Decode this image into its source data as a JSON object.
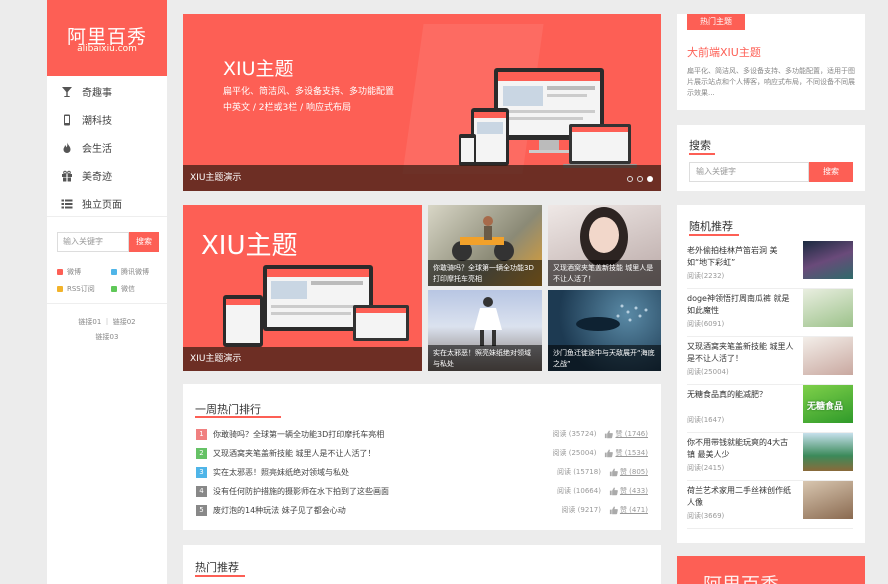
{
  "brand": {
    "name": "阿里百秀",
    "domain": "alibaixiu.com",
    "accent": "#fd5f55"
  },
  "nav": [
    {
      "label": "奇趣事",
      "icon": "glass-icon"
    },
    {
      "label": "潮科技",
      "icon": "phone-icon"
    },
    {
      "label": "会生活",
      "icon": "fire-icon"
    },
    {
      "label": "美奇迹",
      "icon": "gift-icon"
    },
    {
      "label": "独立页面",
      "icon": "list-icon"
    }
  ],
  "sidebar_search": {
    "placeholder": "输入关键字",
    "button": "搜索"
  },
  "social": [
    {
      "label": "微博",
      "color": "#fd5f55"
    },
    {
      "label": "腾讯微博",
      "color": "#4fb5e8"
    },
    {
      "label": "RSS订阅",
      "color": "#f2b32a"
    },
    {
      "label": "微信",
      "color": "#5fc858"
    }
  ],
  "links": {
    "row1": "链接01 ｜ 链接02",
    "row2": "链接03"
  },
  "hero": {
    "title": "XIU主题",
    "line1": "扁平化、简洁风、多设备支持、多功能配置",
    "line2": "中英文 / 2栏或3栏 / 响应式布局",
    "caption": "XIU主题演示"
  },
  "feature": {
    "title": "XIU主题",
    "caption": "XIU主题演示"
  },
  "tiles": [
    "你敢骑吗？全球第一辆全功能3D打印摩托车亮相",
    "又现酒窝夹笔盖新技能 城里人是不让人活了！",
    "实在太邪恶！照亮妹纸绝对领域与私处",
    "沙门鱼迁徙途中与天敌展开“海底之战”"
  ],
  "weekly": {
    "title": "一周热门排行",
    "items": [
      {
        "n": "1",
        "title": "你敢骑吗？全球第一辆全功能3D打印摩托车亮相",
        "views": "阅读 (35724)",
        "likes": "赞 (1746)",
        "color": "#f08080"
      },
      {
        "n": "2",
        "title": "又现酒窝夹笔盖新技能 城里人是不让人活了！",
        "views": "阅读 (25004)",
        "likes": "赞 (1534)",
        "color": "#66c266"
      },
      {
        "n": "3",
        "title": "实在太邪恶！照亮妹纸绝对领域与私处",
        "views": "阅读 (15718)",
        "likes": "赞 (805)",
        "color": "#4fb5e8"
      },
      {
        "n": "4",
        "title": "没有任何防护措施的摄影师在水下拍到了这些画面",
        "views": "阅读 (10664)",
        "likes": "赞 (433)",
        "color": "#888888"
      },
      {
        "n": "5",
        "title": "废灯泡的14种玩法 妹子见了都会心动",
        "views": "阅读 (9217)",
        "likes": "赞 (471)",
        "color": "#888888"
      }
    ]
  },
  "hot": {
    "title": "热门推荐"
  },
  "hot_theme": {
    "badge": "热门主题",
    "title": "大前端XIU主题",
    "desc": "扁平化、简洁风、多设备支持、多功能配置，适用于图片展示站点和个人博客，响应式布局，不同设备不同展示效果..."
  },
  "search_box": {
    "title": "搜索",
    "placeholder": "输入关键字",
    "button": "搜索"
  },
  "random": {
    "title": "随机推荐",
    "items": [
      {
        "title": "老外偷拍桂林芦笛岩洞 美如“地下彩虹”",
        "views": "阅读(2232)"
      },
      {
        "title": "doge神领悟打周南瓜裤 就是如此魔性",
        "views": "阅读(6091)"
      },
      {
        "title": "又现酒窝夹笔盖新技能 城里人是不让人活了！",
        "views": "阅读(25004)"
      },
      {
        "title": "无糖食品真的能减肥？",
        "views": "阅读(1647)",
        "img_text": "无糖食品"
      },
      {
        "title": "你不用带钱就能玩爽的4大古镇 最美人少",
        "views": "阅读(2415)"
      },
      {
        "title": "荷兰艺术家用二手丝袜创作纸人像",
        "views": "阅读(3669)"
      }
    ]
  },
  "bottom_card": {
    "text": "阿里百秀"
  }
}
